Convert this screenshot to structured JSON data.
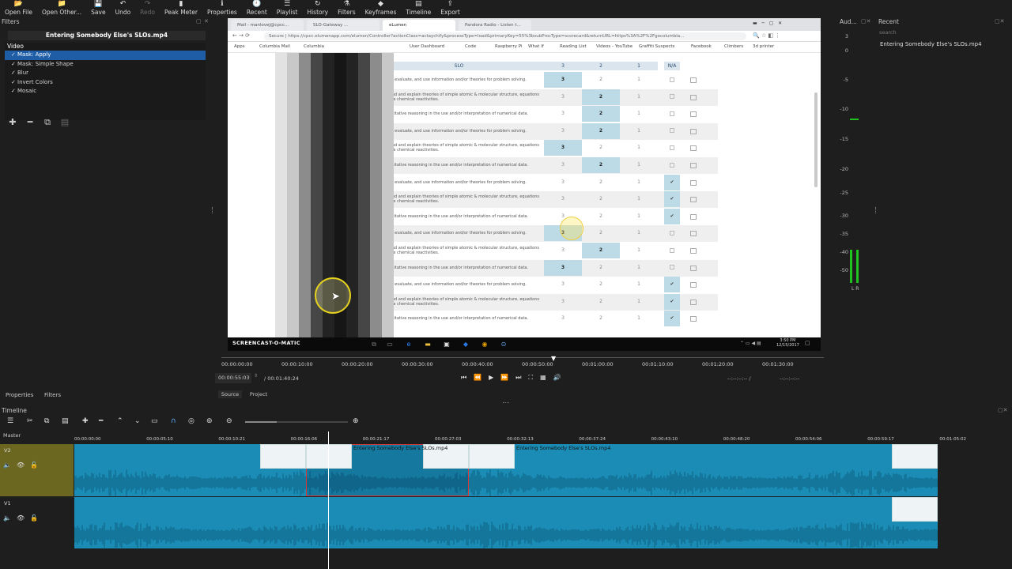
{
  "toolbar": {
    "items": [
      {
        "label": "Open File",
        "icon": "folder-open-icon",
        "enabled": true
      },
      {
        "label": "Open Other...",
        "icon": "folder-icon",
        "enabled": true
      },
      {
        "label": "Save",
        "icon": "save-icon",
        "enabled": true
      },
      {
        "label": "Undo",
        "icon": "undo-icon",
        "enabled": true
      },
      {
        "label": "Redo",
        "icon": "redo-icon",
        "enabled": false
      },
      {
        "label": "Peak Meter",
        "icon": "peak-meter-icon",
        "enabled": true
      },
      {
        "label": "Properties",
        "icon": "properties-icon",
        "enabled": true
      },
      {
        "label": "Recent",
        "icon": "recent-icon",
        "enabled": true
      },
      {
        "label": "Playlist",
        "icon": "playlist-icon",
        "enabled": true
      },
      {
        "label": "History",
        "icon": "history-icon",
        "enabled": true
      },
      {
        "label": "Filters",
        "icon": "filters-icon",
        "enabled": true
      },
      {
        "label": "Keyframes",
        "icon": "keyframes-icon",
        "enabled": true
      },
      {
        "label": "Timeline",
        "icon": "timeline-icon",
        "enabled": true
      },
      {
        "label": "Export",
        "icon": "export-icon",
        "enabled": true
      }
    ]
  },
  "filters_panel": {
    "title": "Filters",
    "clip_name": "Entering Somebody Else's SLOs.mp4",
    "group": "Video",
    "items": [
      {
        "label": "Mask: Apply",
        "selected": true
      },
      {
        "label": "Mask: Simple Shape",
        "selected": false
      },
      {
        "label": "Blur",
        "selected": false
      },
      {
        "label": "Invert Colors",
        "selected": false
      },
      {
        "label": "Mosaic",
        "selected": false
      }
    ]
  },
  "preview": {
    "tabs": [
      "Mail - manlovej@cpcc...",
      "SLO-Gateway ...",
      "eLumen",
      "Pandora Radio - Listen t..."
    ],
    "url": "Secure | https://cpcc.elumenapp.com/elumen/Controller?actionClass=actaychify&processType=load&primaryKey=55%3bsubProcType=scorecard&returnURL=https%3A%2F%2Fgocolumbia...",
    "bookmarks": [
      "Apps",
      "Columbia Mail",
      "Columbia",
      "User Dashboard",
      "Code",
      "Raspberry Pi",
      "What If",
      "Reading List",
      "Videos - YouTube",
      "Graffiti Suspects",
      "Facebook",
      "Climbers",
      "3d printer"
    ],
    "table_header": {
      "slo": "SLO",
      "c3": "3",
      "c2": "2",
      "c1": "1",
      "na": "N/A"
    },
    "rows": [
      {
        "text": "Research, evaluate, and use information and/or theories for problem solving.",
        "sel": "3",
        "na": false
      },
      {
        "text": "Understand and explain theories of simple atomic & molecular structure, equations and simple chemical reactivities.",
        "sel": "2",
        "na": false
      },
      {
        "text": "Use quantitative reasoning in the use and/or interpretation of numerical data.",
        "sel": "2",
        "na": false
      },
      {
        "text": "Research, evaluate, and use information and/or theories for problem solving.",
        "sel": "2",
        "na": false
      },
      {
        "text": "Understand and explain theories of simple atomic & molecular structure, equations and simple chemical reactivities.",
        "sel": "3",
        "na": false
      },
      {
        "text": "Use quantitative reasoning in the use and/or interpretation of numerical data.",
        "sel": "2",
        "na": false
      },
      {
        "text": "Research, evaluate, and use information and/or theories for problem solving.",
        "sel": "na",
        "na": true
      },
      {
        "text": "Understand and explain theories of simple atomic & molecular structure, equations and simple chemical reactivities.",
        "sel": "na",
        "na": true
      },
      {
        "text": "Use quantitative reasoning in the use and/or interpretation of numerical data.",
        "sel": "na",
        "na": true
      },
      {
        "text": "Research, evaluate, and use information and/or theories for problem solving.",
        "sel": "3",
        "na": false
      },
      {
        "text": "Understand and explain theories of simple atomic & molecular structure, equations and simple chemical reactivities.",
        "sel": "2",
        "na": false
      },
      {
        "text": "Use quantitative reasoning in the use and/or interpretation of numerical data.",
        "sel": "3",
        "na": false
      },
      {
        "text": "Research, evaluate, and use information and/or theories for problem solving.",
        "sel": "na",
        "na": true
      },
      {
        "text": "Understand and explain theories of simple atomic & molecular structure, equations and simple chemical reactivities.",
        "sel": "na",
        "na": true
      },
      {
        "text": "Use quantitative reasoning in the use and/or interpretation of numerical data.",
        "sel": "na",
        "na": true
      }
    ],
    "watermark": "SCREENCAST-O-MATIC",
    "clock_time": "3:50 PM",
    "clock_date": "12/15/2017"
  },
  "audio_meter": {
    "title": "Aud...",
    "scale": [
      "3",
      "0",
      "-5",
      "-10",
      "-15",
      "-20",
      "-25",
      "-30",
      "-35",
      "-40",
      "-50"
    ],
    "channels": "L R",
    "level": 0.25
  },
  "recent_panel": {
    "title": "Recent",
    "search_placeholder": "search",
    "items": [
      "Entering Somebody Else's SLOs.mp4"
    ]
  },
  "player": {
    "ruler_labels": [
      "00:00:00:00",
      "00:00:10:00",
      "00:00:20:00",
      "00:00:30:00",
      "00:00:40:00",
      "00:00:50:00",
      "00:01:00:00",
      "00:01:10:00",
      "00:01:20:00",
      "00:01:30:00"
    ],
    "position": "00:00:55:03",
    "duration": "/ 00:01:40:24",
    "in_point": "--:--:--:-- /",
    "out_point": "--:--:--:--",
    "tabs": [
      "Source",
      "Project"
    ],
    "left_tabs": [
      "Properties",
      "Filters"
    ]
  },
  "timeline": {
    "title": "Timeline",
    "master_label": "Master",
    "ruler_labels": [
      "00:00:00:00",
      "00:00:05:10",
      "00:00:10:21",
      "00:00:16:06",
      "00:00:21:17",
      "00:00:27:03",
      "00:00:32:13",
      "00:00:37:24",
      "00:00:43:10",
      "00:00:48:20",
      "00:00:54:06",
      "00:00:59:17",
      "00:01:05:02"
    ],
    "tracks": [
      {
        "name": "V2",
        "clip_label_a": "Entering Somebody Else's SLOs.mp4",
        "clip_label_b": "Entering Somebody Else's SLOs.mp4"
      },
      {
        "name": "V1"
      }
    ]
  },
  "colors": {
    "accent": "#1f5ea7",
    "track_clip": "#1a8cb5",
    "v2_header": "#6b6620",
    "highlight_cell": "#bcdbe6"
  }
}
